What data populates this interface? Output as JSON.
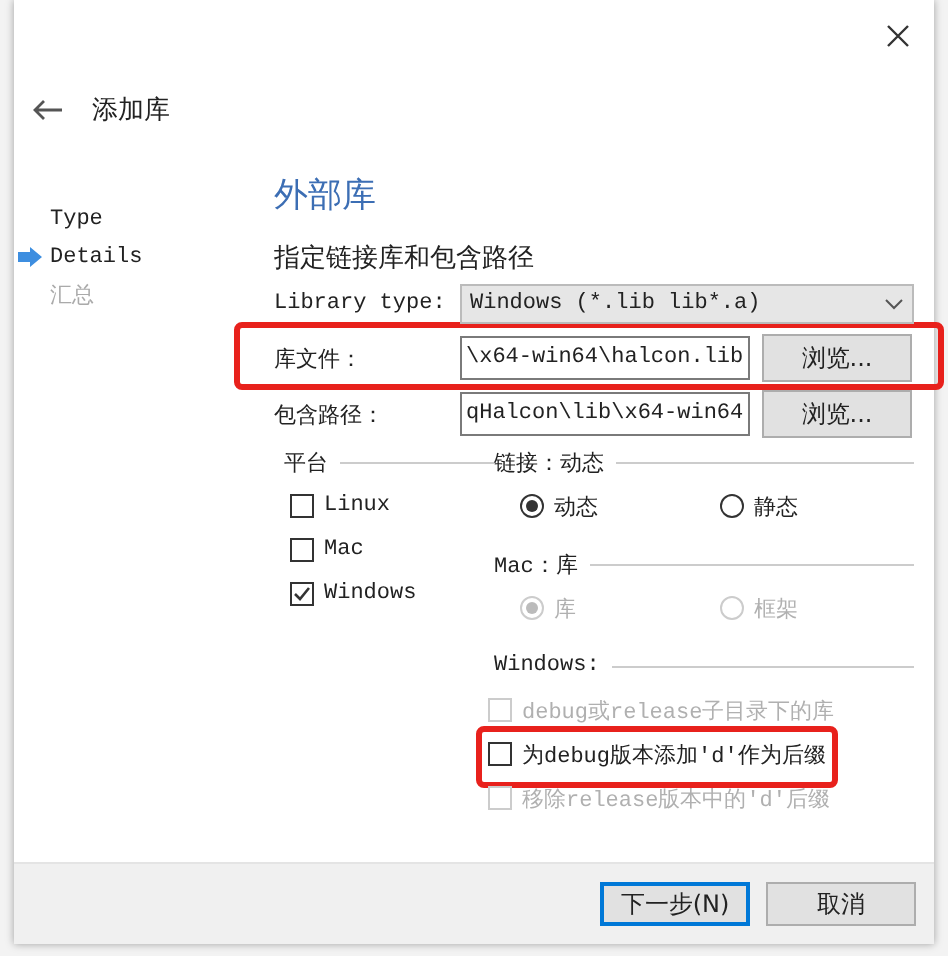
{
  "header": {
    "title": "添加库"
  },
  "steps": [
    {
      "label": "Type",
      "selected": false,
      "disabled": false
    },
    {
      "label": "Details",
      "selected": true,
      "disabled": false
    },
    {
      "label": "汇总",
      "selected": false,
      "disabled": true
    }
  ],
  "page": {
    "heading": "外部库",
    "subtitle": "指定链接库和包含路径"
  },
  "library_type": {
    "label": "Library type:",
    "value": "Windows (*.lib lib*.a)"
  },
  "paths": [
    {
      "label": "库文件：",
      "value": "\\x64-win64\\halcon.lib",
      "button": "浏览...",
      "highlighted": true
    },
    {
      "label": "包含路径：",
      "value": "qHalcon\\lib\\x64-win64",
      "button": "浏览...",
      "highlighted": false
    }
  ],
  "platform": {
    "title": "平台",
    "options": [
      {
        "label": "Linux",
        "checked": false
      },
      {
        "label": "Mac",
        "checked": false
      },
      {
        "label": "Windows",
        "checked": true
      }
    ]
  },
  "linkage": {
    "title": "链接：动态",
    "options": [
      {
        "label": "动态",
        "selected": true,
        "disabled": false
      },
      {
        "label": "静态",
        "selected": false,
        "disabled": false
      }
    ]
  },
  "mac": {
    "title": "Mac：库",
    "options": [
      {
        "label": "库",
        "selected": true,
        "disabled": true
      },
      {
        "label": "框架",
        "selected": false,
        "disabled": true
      }
    ]
  },
  "windows": {
    "title": "Windows:",
    "options": [
      {
        "label": "debug或release子目录下的库",
        "checked": false,
        "disabled": true,
        "highlighted": false
      },
      {
        "label": "为debug版本添加'd'作为后缀",
        "checked": false,
        "disabled": false,
        "highlighted": true
      },
      {
        "label": "移除release版本中的'd'后缀",
        "checked": false,
        "disabled": true,
        "highlighted": false
      }
    ]
  },
  "buttons": [
    {
      "label": "下一步(N)",
      "default": true
    },
    {
      "label": "取消",
      "default": false
    }
  ]
}
